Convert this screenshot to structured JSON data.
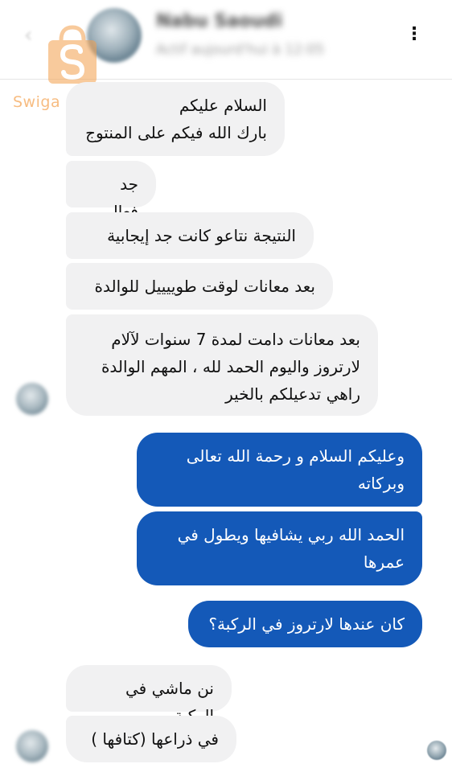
{
  "header": {
    "contact_name": "Nabu Saoudi",
    "status": "Actif aujourd'hui à 12:05"
  },
  "watermark": {
    "text": "Swiga | سويقة",
    "logo_color": "#f4a04d"
  },
  "messages_incoming_1": [
    {
      "text": "السلام عليكم\nبارك الله فيكم على المنتوج"
    },
    {
      "text": "جد فعال"
    },
    {
      "text": "النتيجة نتاعو كانت جد إيجابية"
    },
    {
      "text": "بعد معانات لوقت طوييييل للوالدة"
    },
    {
      "text": "بعد معانات دامت لمدة 7 سنوات لآلام\nلارتروز واليوم الحمد لله ، المهم الوالدة\nراهي تدعيلكم بالخير"
    }
  ],
  "messages_outgoing": [
    {
      "text": "وعليكم السلام و رحمة الله تعالى\nوبركاته"
    },
    {
      "text": "الحمد الله ربي يشافيها ويطول في\nعمرها"
    },
    {
      "text": "كان عندها لارتروز في الركبة؟"
    }
  ],
  "messages_incoming_2": [
    {
      "text": "نن ماشي في الركبة"
    },
    {
      "text": "في ذراعها  (كتافها )"
    }
  ],
  "colors": {
    "outgoing_bubble": "#1459b8",
    "incoming_bubble": "#f1f1f2"
  },
  "icons": {
    "back": "back-arrow-icon",
    "more": "more-vertical-icon"
  }
}
